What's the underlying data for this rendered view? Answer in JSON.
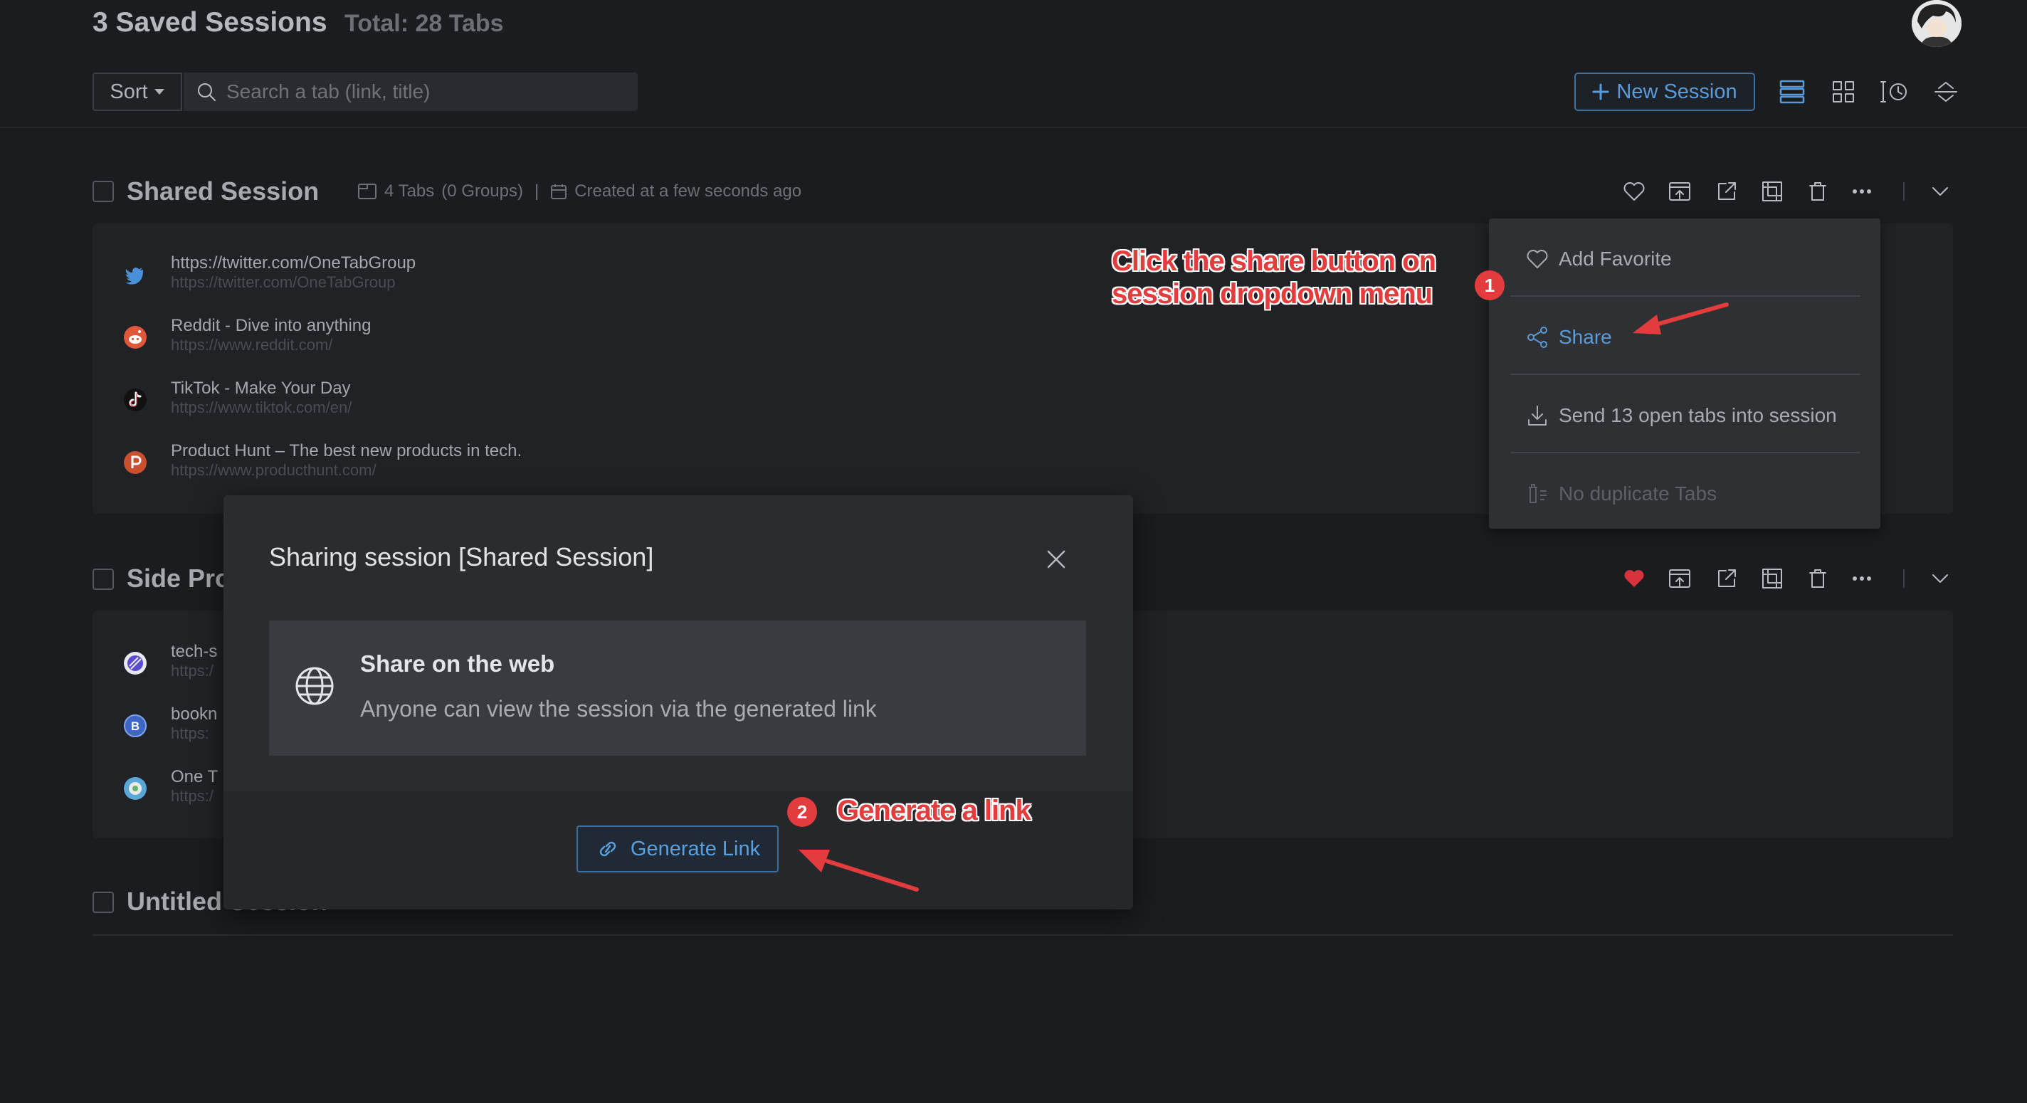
{
  "header": {
    "title": "3 Saved Sessions",
    "total": "Total: 28 Tabs",
    "sort_label": "Sort",
    "search_placeholder": "Search a tab (link, title)",
    "new_session_label": "New Session"
  },
  "sessions": [
    {
      "name": "Shared Session",
      "tabs_count": "4 Tabs",
      "groups": "(0 Groups)",
      "created": "Created at a few seconds ago",
      "favorite": false,
      "tabs": [
        {
          "title": "https://twitter.com/OneTabGroup",
          "url": "https://twitter.com/OneTabGroup",
          "icon": "twitter-icon"
        },
        {
          "title": "Reddit - Dive into anything",
          "url": "https://www.reddit.com/",
          "icon": "reddit-icon"
        },
        {
          "title": "TikTok - Make Your Day",
          "url": "https://www.tiktok.com/en/",
          "icon": "tiktok-icon"
        },
        {
          "title": "Product Hunt – The best new products in tech.",
          "url": "https://www.producthunt.com/",
          "icon": "producthunt-icon"
        }
      ]
    },
    {
      "name": "Side Pro",
      "favorite": true,
      "tabs": [
        {
          "title": "tech-s",
          "url": "https:/",
          "icon": "linear-icon"
        },
        {
          "title": "bookn",
          "url": "https:",
          "icon": "bookmark-b-icon"
        },
        {
          "title": "One T",
          "url": "https:/",
          "icon": "onetab-icon"
        }
      ]
    },
    {
      "name": "Untitled Session"
    }
  ],
  "dropdown": {
    "items": [
      {
        "label": "Add Favorite",
        "icon": "heart-icon",
        "color": "#a9abb0"
      },
      {
        "label": "Share",
        "icon": "share-icon",
        "color": "#5a9bd8"
      },
      {
        "label": "Send 13 open tabs into session",
        "icon": "download-icon",
        "color": "#a9abb0"
      },
      {
        "label": "No duplicate Tabs",
        "icon": "dedupe-icon",
        "color": "#5e6066"
      }
    ]
  },
  "modal": {
    "title": "Sharing session [Shared Session]",
    "card_title": "Share on the web",
    "card_desc": "Anyone can view the session via the generated link",
    "button_label": "Generate Link"
  },
  "annotations": {
    "step1_badge": "1",
    "step1_line1": "Click the share button on",
    "step1_line2": "session dropdown menu",
    "step2_badge": "2",
    "step2_text": "Generate a link",
    "accent_color": "#e23c3c"
  }
}
